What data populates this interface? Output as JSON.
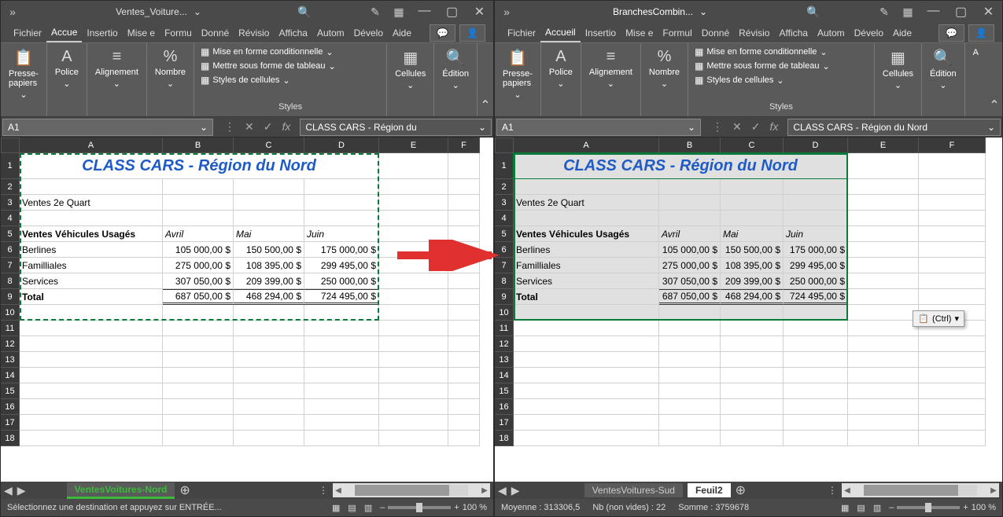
{
  "left": {
    "title": "Ventes_Voiture...",
    "menu": [
      "Fichier",
      "Accue",
      "Insertio",
      "Mise e",
      "Formu",
      "Donné",
      "Révisio",
      "Afficha",
      "Autom",
      "Dévelo",
      "Aide"
    ],
    "ribbon": {
      "clipboard": "Presse-\npapiers",
      "police": "Police",
      "align": "Alignement",
      "nombre": "Nombre",
      "styles": "Styles",
      "s1": "Mise en forme conditionnelle",
      "s2": "Mettre sous forme de tableau",
      "s3": "Styles de cellules",
      "cells": "Cellules",
      "edit": "Édition"
    },
    "namebox": "A1",
    "formula": "CLASS CARS - Région du",
    "cols": [
      "A",
      "B",
      "C",
      "D",
      "E",
      "F"
    ],
    "sheet_title": "CLASS CARS - Région du Nord",
    "subtitle": "Ventes 2e Quart",
    "h5": "Ventes Véhicules Usagés",
    "h5b": "Avril",
    "h5c": "Mai",
    "h5d": "Juin",
    "r6a": "Berlines",
    "r6b": "105 000,00  $",
    "r6c": "150 500,00  $",
    "r6d": "175 000,00  $",
    "r7a": "Familliales",
    "r7b": "275 000,00  $",
    "r7c": "108 395,00  $",
    "r7d": "299 495,00  $",
    "r8a": "Services",
    "r8b": "307 050,00  $",
    "r8c": "209 399,00  $",
    "r8d": "250 000,00  $",
    "r9a": "Total",
    "r9b": "687 050,00  $",
    "r9c": "468 294,00  $",
    "r9d": "724 495,00  $",
    "tab1": "VentesVoitures-Nord",
    "status": "Sélectionnez une destination et appuyez sur ENTRÉE...",
    "zoom": "100 %"
  },
  "right": {
    "title": "BranchesCombin...",
    "menu": [
      "Fichier",
      "Accueil",
      "Insertio",
      "Mise e",
      "Formul",
      "Donné",
      "Révisio",
      "Afficha",
      "Autom",
      "Dévelo",
      "Aide"
    ],
    "namebox": "A1",
    "formula": "CLASS CARS - Région du Nord",
    "cols": [
      "A",
      "B",
      "C",
      "D",
      "E",
      "F"
    ],
    "tab1": "VentesVoitures-Sud",
    "tab2": "Feuil2",
    "status_avg": "Moyenne : 313306,5",
    "status_cnt": "Nb (non vides) : 22",
    "status_sum": "Somme : 3759678",
    "zoom": "100 %",
    "paste_label": "(Ctrl)"
  }
}
